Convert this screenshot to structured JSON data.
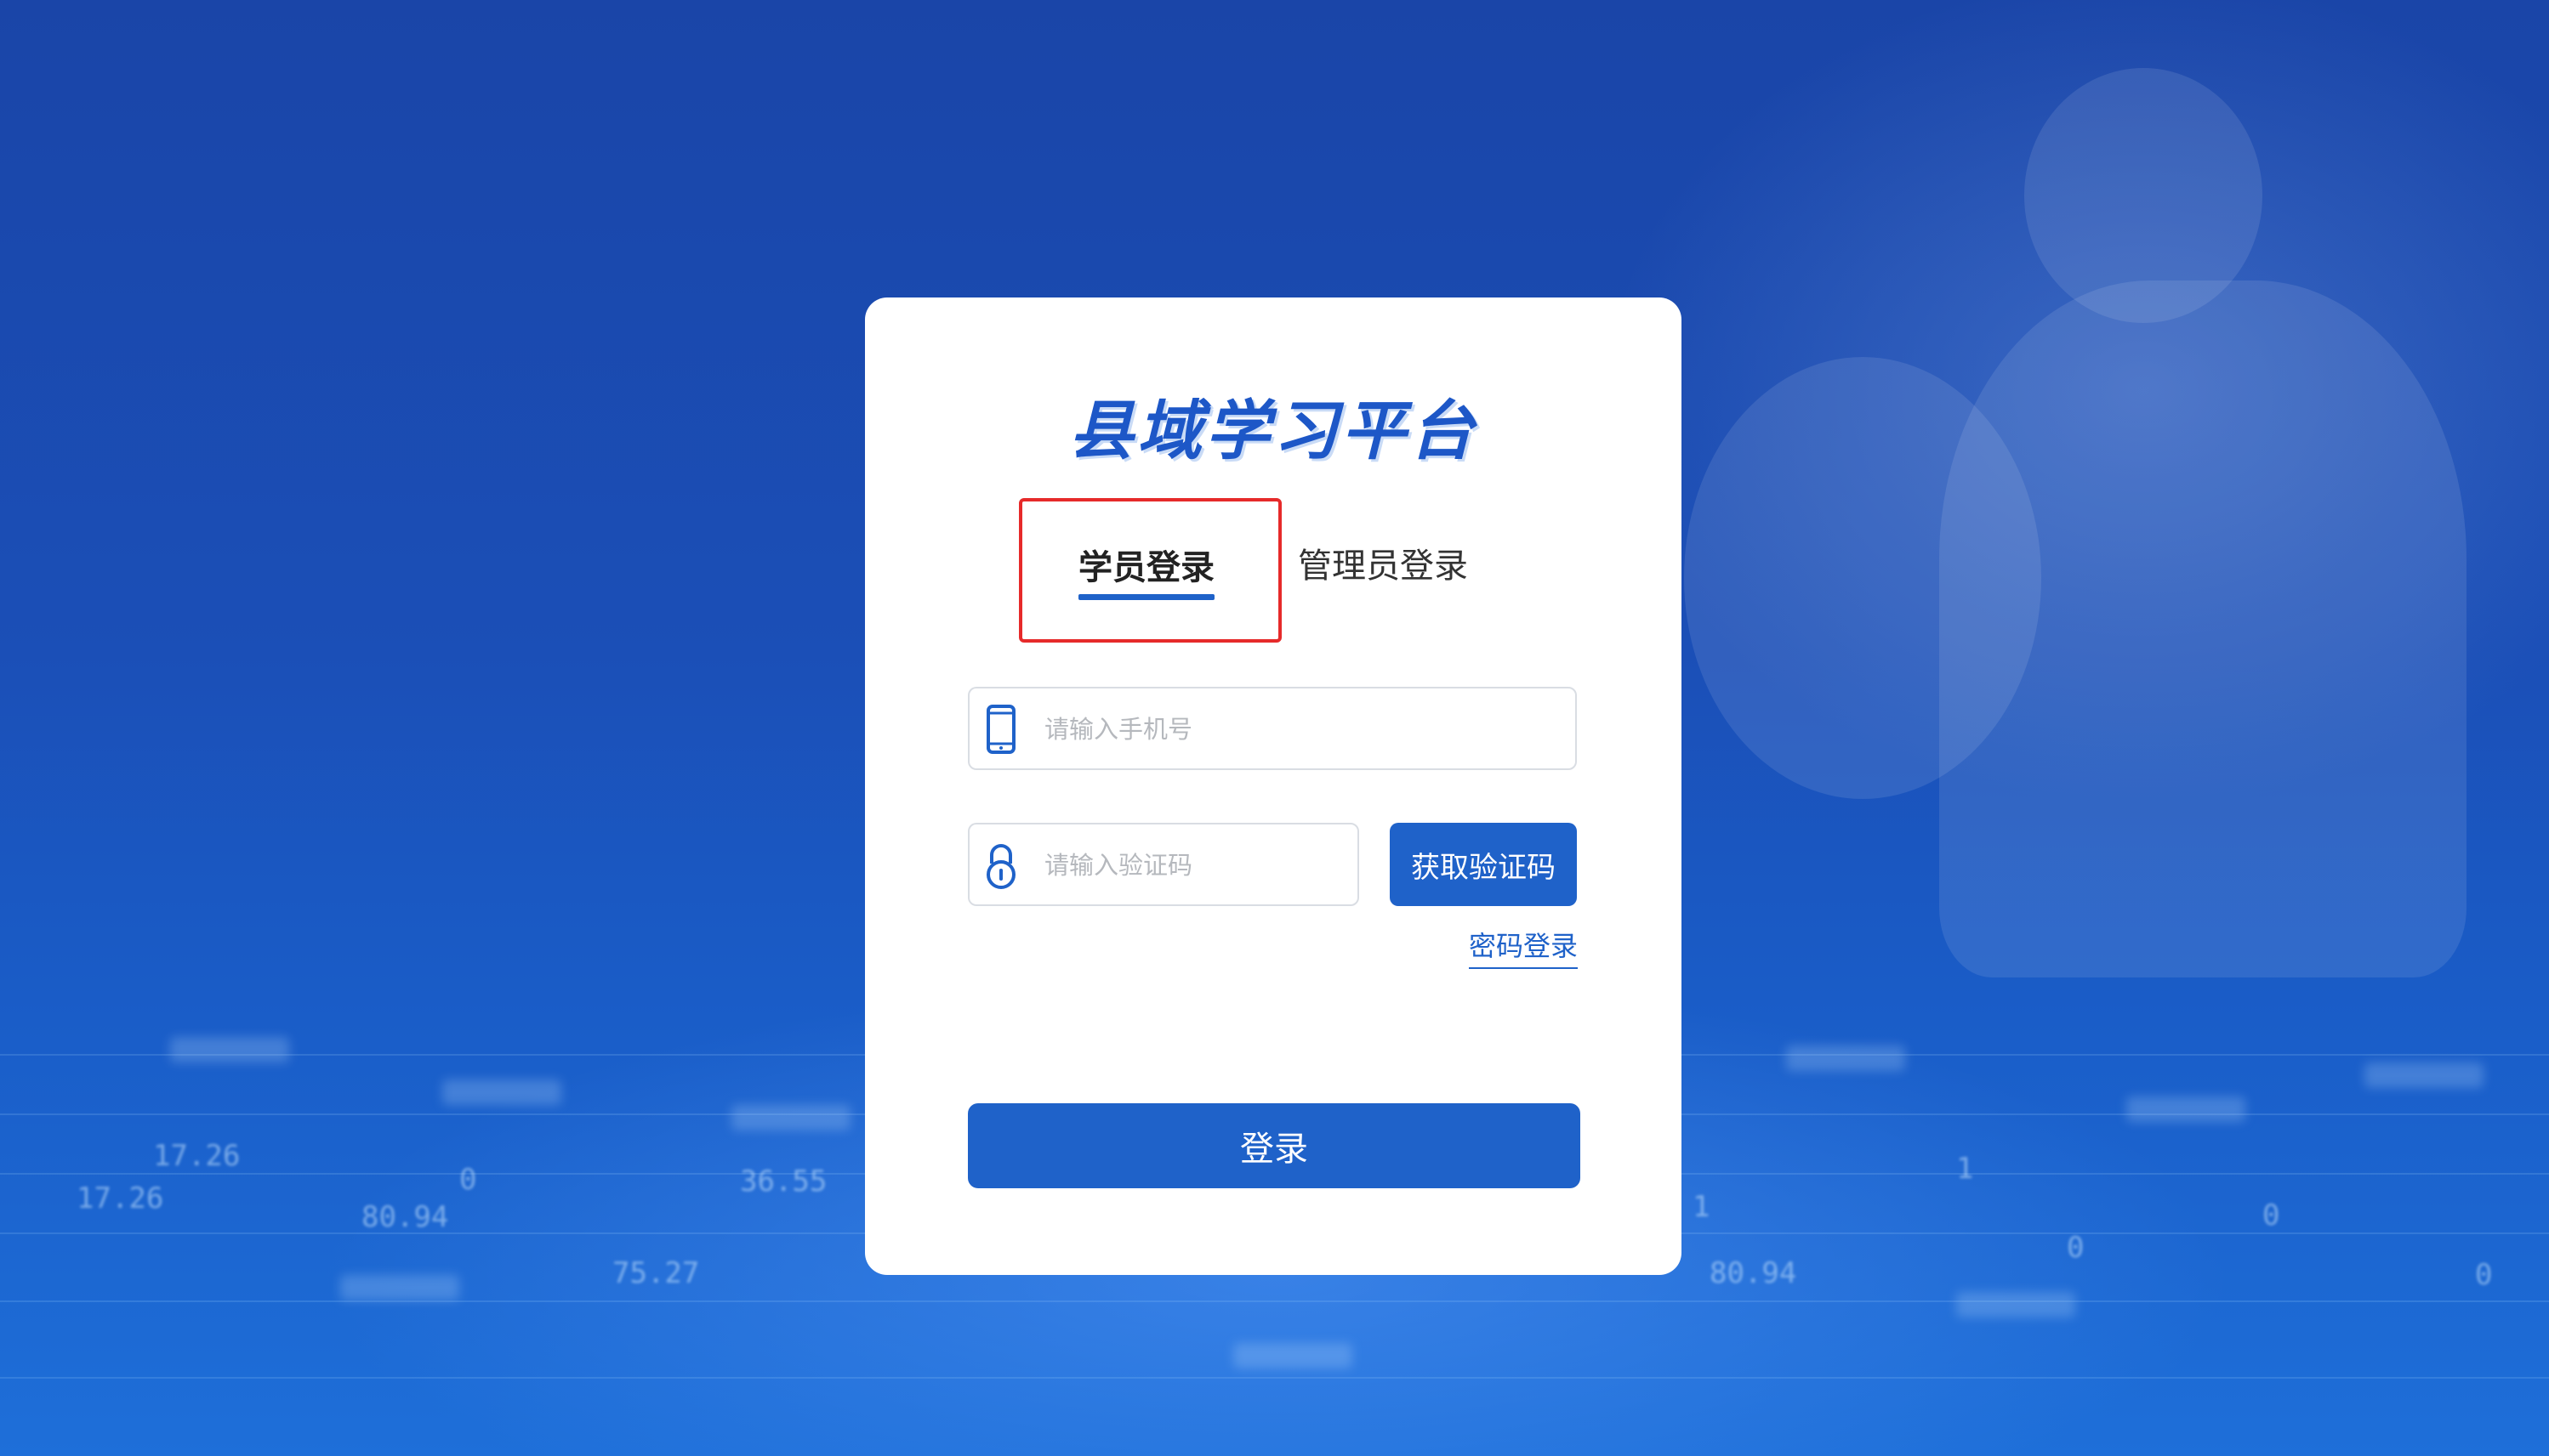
{
  "app": {
    "title": "县域学习平台"
  },
  "tabs": [
    {
      "label": "学员登录",
      "active": true
    },
    {
      "label": "管理员登录",
      "active": false
    }
  ],
  "form": {
    "phone_placeholder": "请输入手机号",
    "phone_value": "",
    "code_placeholder": "请输入验证码",
    "code_value": "",
    "get_code_label": "获取验证码",
    "password_login_label": "密码登录",
    "submit_label": "登录"
  },
  "background_digits": [
    "17.26",
    "80.94",
    "36.55",
    "75.27",
    "80.94",
    "17.26",
    "0",
    "0",
    "1",
    "1",
    "0",
    "0"
  ],
  "icons": {
    "phone": "mobile-phone-icon",
    "code": "lock-icon"
  },
  "colors": {
    "accent": "#1f62c9",
    "highlight_box": "#e62a2a",
    "background": "#1b4fb7"
  }
}
